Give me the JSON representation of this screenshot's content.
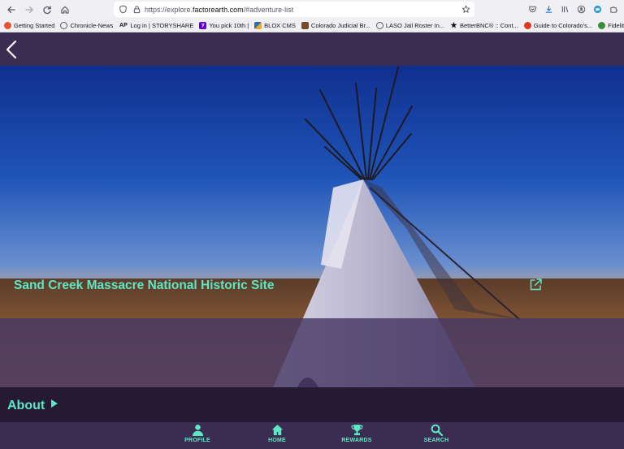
{
  "browser": {
    "url_scheme": "https://explore.",
    "url_host": "factorearth.com",
    "url_path": "/#adventure-list",
    "bookmarks": [
      {
        "label": "Getting Started",
        "icon": "firefox-icon",
        "color": "#e8532b"
      },
      {
        "label": "Chronicle-News",
        "icon": "globe-icon",
        "color": "#5b5b66"
      },
      {
        "label": "Log in | STORYSHARE",
        "icon": "ap-icon",
        "color": "#c8102e"
      },
      {
        "label": "You pick 10th |",
        "icon": "yahoo-icon",
        "color": "#6001d2"
      },
      {
        "label": "BLOX CMS",
        "icon": "blox-icon",
        "color": "#2b6cb0"
      },
      {
        "label": "Colorado Judicial Br...",
        "icon": "court-icon",
        "color": "#7a4b2a"
      },
      {
        "label": "LASO Jail Roster In...",
        "icon": "globe-icon",
        "color": "#5b5b66"
      },
      {
        "label": "BetterBNC® :: Cont...",
        "icon": "star-icon",
        "color": "#111111"
      },
      {
        "label": "Guide to Colorado's...",
        "icon": "colorado-icon",
        "color": "#e03a1e"
      },
      {
        "label": "Fidelity.com",
        "icon": "fidelity-icon",
        "color": "#3c8a3e"
      }
    ]
  },
  "site": {
    "title": "Sand Creek Massacre National Historic Site",
    "about_label": "About"
  },
  "nav": {
    "items": [
      {
        "label": "PROFILE",
        "icon": "person-icon"
      },
      {
        "label": "HOME",
        "icon": "home-icon"
      },
      {
        "label": "REWARDS",
        "icon": "trophy-icon"
      },
      {
        "label": "SEARCH",
        "icon": "search-icon"
      }
    ]
  },
  "colors": {
    "accent": "#5ee7c4",
    "header_bg": "#3b2c52",
    "about_bg": "#241a31"
  }
}
